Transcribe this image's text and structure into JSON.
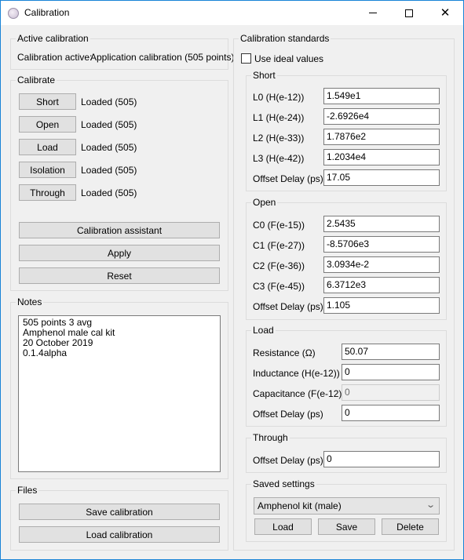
{
  "window": {
    "title": "Calibration",
    "controls": {
      "minimize": "minimize",
      "maximize": "maximize",
      "close": "✕"
    }
  },
  "active_calibration": {
    "legend": "Active calibration",
    "label": "Calibration active:",
    "value": "Application calibration (505 points)"
  },
  "calibrate": {
    "legend": "Calibrate",
    "standards": [
      {
        "button": "Short",
        "status": "Loaded (505)"
      },
      {
        "button": "Open",
        "status": "Loaded (505)"
      },
      {
        "button": "Load",
        "status": "Loaded (505)"
      },
      {
        "button": "Isolation",
        "status": "Loaded (505)"
      },
      {
        "button": "Through",
        "status": "Loaded (505)"
      }
    ],
    "assistant_button": "Calibration assistant",
    "apply_button": "Apply",
    "reset_button": "Reset"
  },
  "notes": {
    "legend": "Notes",
    "lines": [
      "505 points 3 avg",
      "Amphenol male cal kit",
      "20 October 2019",
      "0.1.4alpha"
    ]
  },
  "files": {
    "legend": "Files",
    "save_button": "Save calibration",
    "load_button": "Load calibration"
  },
  "standards": {
    "legend": "Calibration standards",
    "use_ideal": {
      "label": "Use ideal values",
      "checked": false
    },
    "short": {
      "legend": "Short",
      "fields": [
        {
          "label": "L0 (H(e-12))",
          "value": "1.549e1"
        },
        {
          "label": "L1 (H(e-24))",
          "value": "-2.6926e4"
        },
        {
          "label": "L2 (H(e-33))",
          "value": "1.7876e2"
        },
        {
          "label": "L3 (H(e-42))",
          "value": "1.2034e4"
        },
        {
          "label": "Offset Delay (ps)",
          "value": "17.05"
        }
      ]
    },
    "open": {
      "legend": "Open",
      "fields": [
        {
          "label": "C0 (F(e-15))",
          "value": "2.5435"
        },
        {
          "label": "C1 (F(e-27))",
          "value": "-8.5706e3"
        },
        {
          "label": "C2 (F(e-36))",
          "value": "3.0934e-2"
        },
        {
          "label": "C3 (F(e-45))",
          "value": "6.3712e3"
        },
        {
          "label": "Offset Delay (ps)",
          "value": "1.105"
        }
      ]
    },
    "load": {
      "legend": "Load",
      "fields": [
        {
          "label": "Resistance (Ω)",
          "value": "50.07"
        },
        {
          "label": "Inductance (H(e-12))",
          "value": "0"
        },
        {
          "label": "Capacitance (F(e-12))",
          "value": "0"
        },
        {
          "label": "Offset Delay (ps)",
          "value": "0"
        }
      ]
    },
    "through": {
      "legend": "Through",
      "fields": [
        {
          "label": "Offset Delay (ps)",
          "value": "0"
        }
      ]
    },
    "saved": {
      "legend": "Saved settings",
      "selected": "Amphenol kit (male)",
      "load_button": "Load",
      "save_button": "Save",
      "delete_button": "Delete"
    }
  }
}
